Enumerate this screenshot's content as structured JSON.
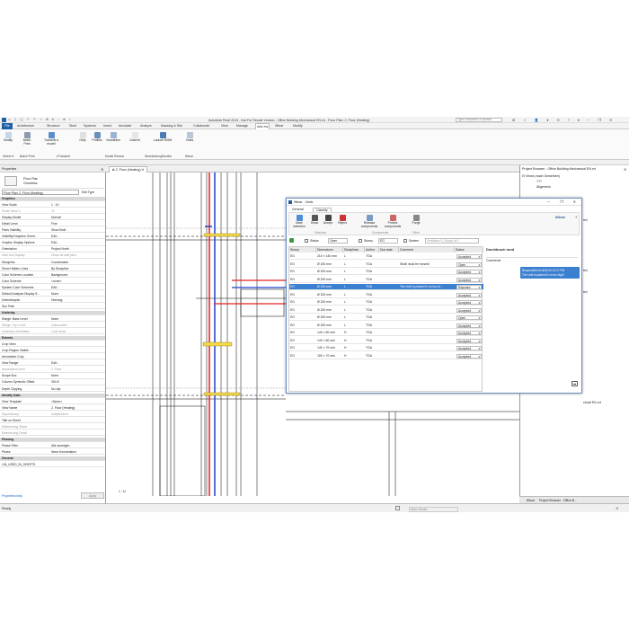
{
  "window_title": "Autodesk Revit 2019 - Not For Resale Version - Office Building Mechanical EN.rvt - Floor Plan: 2. Floor (Heating)",
  "search_placeholder": "Type a keyword or phrase",
  "ribbon_tabs": [
    "File",
    "Architecture",
    "Structure",
    "Steel",
    "Systems",
    "Insert",
    "Annotate",
    "Analyze",
    "Massing & Site",
    "Collaborate",
    "View",
    "Manage",
    "Add-Ins",
    "Modify"
  ],
  "ribbon_tabs_extra": [
    "Modify",
    "Batch Print",
    "Transmit a model",
    "Profiles",
    "Voreadgaben",
    "Ansicht",
    "Launch WSM",
    "Voids"
  ],
  "ribbon_buttons": [
    {
      "label": "Modify"
    },
    {
      "label": "Batch Print"
    },
    {
      "label": "Transmit a model"
    },
    {
      "label": "Help"
    },
    {
      "label": "Profiles"
    },
    {
      "label": "Vorwahlen"
    },
    {
      "label": "Ansicht"
    },
    {
      "label": "Launch WSM"
    },
    {
      "label": "Voids"
    }
  ],
  "ribbon_groups": [
    "Select ▾",
    "Batch Print",
    "eTransmit",
    "Model Review",
    "WorksharingMonitor",
    "liNear"
  ],
  "properties": {
    "title": "Properties",
    "type_name": "Floor Plan",
    "type_sub": "Grundriss",
    "selector": "Floor Plan: 2. Floor (Heating)",
    "edit_type": "Edit Type",
    "rows": [
      {
        "k": "Graphics",
        "v": "",
        "sec": true
      },
      {
        "k": "View Scale",
        "v": "1 : 10"
      },
      {
        "k": "Scale Value 1:",
        "v": "10",
        "grey": true
      },
      {
        "k": "Display Model",
        "v": "Normal"
      },
      {
        "k": "Detail Level",
        "v": "Fine"
      },
      {
        "k": "Parts Visibility",
        "v": "Show Both"
      },
      {
        "k": "Visibility/Graphics Overri...",
        "v": "Edit..."
      },
      {
        "k": "Graphic Display Options",
        "v": "Edit..."
      },
      {
        "k": "Orientation",
        "v": "Project North"
      },
      {
        "k": "Wall Join Display",
        "v": "Clean all wall joins",
        "grey": true
      },
      {
        "k": "Discipline",
        "v": "Coordination"
      },
      {
        "k": "Show Hidden Lines",
        "v": "By Discipline"
      },
      {
        "k": "Color Scheme Location",
        "v": "Background"
      },
      {
        "k": "Color Scheme",
        "v": "<none>"
      },
      {
        "k": "System Color Schemes",
        "v": "Edit..."
      },
      {
        "k": "Default Analysis Display S...",
        "v": "None"
      },
      {
        "k": "Unterdisziplin",
        "v": "Heizung"
      },
      {
        "k": "Sun Path",
        "v": ""
      },
      {
        "k": "Underlay",
        "v": "",
        "sec": true
      },
      {
        "k": "Range: Base Level",
        "v": "None"
      },
      {
        "k": "Range: Top Level",
        "v": "Unbounded",
        "grey": true
      },
      {
        "k": "Underlay Orientation",
        "v": "Look down",
        "grey": true
      },
      {
        "k": "Extents",
        "v": "",
        "sec": true
      },
      {
        "k": "Crop View",
        "v": ""
      },
      {
        "k": "Crop Region Visible",
        "v": ""
      },
      {
        "k": "Annotation Crop",
        "v": ""
      },
      {
        "k": "View Range",
        "v": "Edit..."
      },
      {
        "k": "Associated Level",
        "v": "2. Floor",
        "grey": true
      },
      {
        "k": "Scope Box",
        "v": "None"
      },
      {
        "k": "Column Symbolic Offset",
        "v": "304.8"
      },
      {
        "k": "Depth Clipping",
        "v": "No clip"
      },
      {
        "k": "Identity Data",
        "v": "",
        "sec": true
      },
      {
        "k": "View Template",
        "v": "<None>"
      },
      {
        "k": "View Name",
        "v": "2. Floor (Heating)"
      },
      {
        "k": "Dependency",
        "v": "Independent",
        "grey": true
      },
      {
        "k": "Title on Sheet",
        "v": ""
      },
      {
        "k": "Referencing Sheet",
        "v": "",
        "grey": true
      },
      {
        "k": "Referencing Detail",
        "v": "",
        "grey": true
      },
      {
        "k": "Phasing",
        "v": "",
        "sec": true
      },
      {
        "k": "Phase Filter",
        "v": "Alle anzeigen"
      },
      {
        "k": "Phase",
        "v": "Neue Konstruktion"
      },
      {
        "k": "General",
        "v": "",
        "sec": true
      },
      {
        "k": "LIN_USED_IN_SHEETS",
        "v": ""
      }
    ],
    "help_link": "Properties help",
    "apply": "Apply"
  },
  "view_tab": "2. Floor (Heating)",
  "scale_label": "1 : 10",
  "project_browser": {
    "title": "Project Browser - Office Building Mechanical EN.rvt",
    "root": "Views (nach Gewerken)",
    "items": [
      "???",
      "Allgemein"
    ],
    "partial": [
      "ter)",
      "ter)",
      "ter)",
      "ctural EN.rvt"
    ]
  },
  "bottom_tabs": [
    "liNear",
    "Project Browser - Office B..."
  ],
  "status": {
    "left": "Ready",
    "model": "Main Model",
    "right": ":0"
  },
  "dialog": {
    "title": "liNear - Voids",
    "tabs": [
      "General",
      "Classify"
    ],
    "toolbar": [
      {
        "label": "Mark selection"
      },
      {
        "label": "Show"
      },
      {
        "label": "Accept"
      },
      {
        "label": "Reject"
      },
      {
        "label": "Release components"
      },
      {
        "label": "Protect components"
      },
      {
        "label": "Purge"
      }
    ],
    "toolbar_groups": [
      "Selection",
      "Components",
      "Other"
    ],
    "brand": "liNear",
    "filter": {
      "status_label": "Status",
      "status_value": "Open",
      "storey_label": "Storey",
      "storey_value": "EG",
      "system_label": "System",
      "system_value": "Ventilation 5_Supply Air 2"
    },
    "columns": [
      "Storey",
      "Dimensions",
      "Disciplines",
      "Author",
      "Due date",
      "Comment",
      "Status"
    ],
    "rows": [
      {
        "storey": "EG",
        "dim": "210 × 140 mm",
        "disc": "L",
        "author": "TGA",
        "due": "",
        "comment": "",
        "status": "Accepted"
      },
      {
        "storey": "EG",
        "dim": "Ø 200 mm",
        "disc": "L",
        "author": "TGA",
        "due": "",
        "comment": "Shaft must be moved!",
        "status": "Open"
      },
      {
        "storey": "EG",
        "dim": "Ø 200 mm",
        "disc": "L",
        "author": "TGA",
        "due": "",
        "comment": "",
        "status": "Accepted"
      },
      {
        "storey": "EG",
        "dim": "Ø 200 mm",
        "disc": "L",
        "author": "TGA",
        "due": "",
        "comment": "",
        "status": "Accepted"
      },
      {
        "storey": "EG",
        "dim": "Ø 200 mm",
        "disc": "L",
        "author": "TGA",
        "due": "",
        "comment": "The void is placed 8 cm too hi...",
        "status": "Rejected",
        "sel": true
      },
      {
        "storey": "EG",
        "dim": "Ø 200 mm",
        "disc": "L",
        "author": "TGA",
        "due": "",
        "comment": "",
        "status": "Accepted"
      },
      {
        "storey": "EG",
        "dim": "Ø 200 mm",
        "disc": "L",
        "author": "TGA",
        "due": "",
        "comment": "",
        "status": "Accepted"
      },
      {
        "storey": "EG",
        "dim": "Ø 200 mm",
        "disc": "L",
        "author": "TGA",
        "due": "",
        "comment": "",
        "status": "Accepted"
      },
      {
        "storey": "EG",
        "dim": "Ø 200 mm",
        "disc": "L",
        "author": "TGA",
        "due": "",
        "comment": "",
        "status": "Open"
      },
      {
        "storey": "EG",
        "dim": "Ø 200 mm",
        "disc": "L",
        "author": "TGA",
        "due": "",
        "comment": "",
        "status": "Accepted"
      },
      {
        "storey": "EG",
        "dim": "140 × 60 mm",
        "disc": "H",
        "author": "TGA",
        "due": "",
        "comment": "",
        "status": "Accepted"
      },
      {
        "storey": "EG",
        "dim": "140 × 60 mm",
        "disc": "H",
        "author": "TGA",
        "due": "",
        "comment": "",
        "status": "Accepted"
      },
      {
        "storey": "EG",
        "dim": "140 × 70 mm",
        "disc": "H",
        "author": "TGA",
        "due": "",
        "comment": "",
        "status": "Accepted"
      },
      {
        "storey": "EG",
        "dim": "150 × 70 mm",
        "disc": "H",
        "author": "TGA",
        "due": "",
        "comment": "",
        "status": "Accepted"
      }
    ],
    "side_title": "Durchbruch rund",
    "comments_label": "Comments",
    "bubble_author": "Responsible 6/18/2019 12:27 PM",
    "bubble_text": "The void is placed 8 cm too high!"
  }
}
